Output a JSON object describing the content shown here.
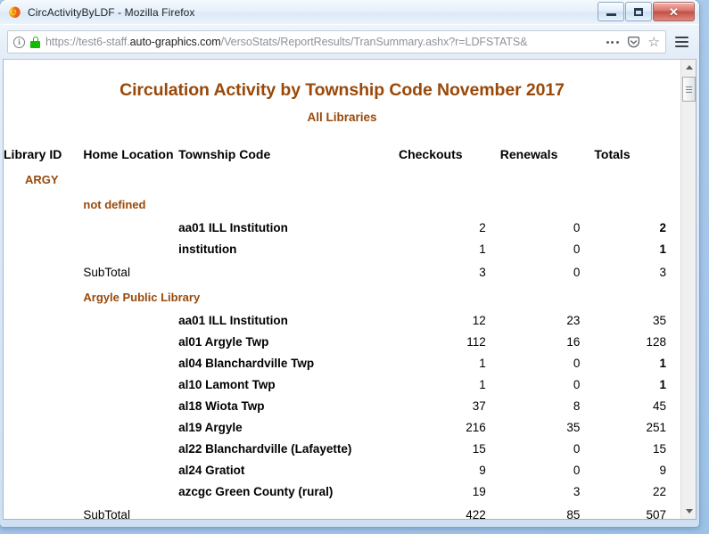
{
  "window": {
    "title": "CircActivityByLDF - Mozilla Firefox",
    "minimize_label": "Minimize",
    "maximize_label": "Maximize",
    "close_label": "✕"
  },
  "browser": {
    "url_prefix": "https://test6-staff.",
    "url_domain": "auto-graphics.com",
    "url_suffix": "/VersoStats/ReportResults/TranSummary.ashx?r=LDFSTATS&",
    "info_glyph": "i",
    "star_glyph": "☆",
    "icons": {
      "info": "info-icon",
      "lock": "padlock-icon",
      "page_actions": "ellipsis-icon",
      "pocket": "pocket-icon",
      "bookmark": "star-icon",
      "menu": "hamburger-icon"
    }
  },
  "report": {
    "title": "Circulation Activity by Township Code  November 2017",
    "subtitle": "All Libraries",
    "columns": [
      "Library ID",
      "Home Location",
      "Township Code",
      "Checkouts",
      "Renewals",
      "Totals"
    ],
    "rows": [
      {
        "kind": "library",
        "label": "ARGY"
      },
      {
        "kind": "home",
        "label": "not defined"
      },
      {
        "kind": "data",
        "label": "aa01 ILL Institution",
        "checkouts": "2",
        "renewals": "0",
        "totals": "2",
        "totals_bold": true
      },
      {
        "kind": "data",
        "label": "institution",
        "checkouts": "1",
        "renewals": "0",
        "totals": "1",
        "totals_bold": true
      },
      {
        "kind": "subtotal",
        "label": "SubTotal",
        "checkouts": "3",
        "renewals": "0",
        "totals": "3",
        "totals_bold": false
      },
      {
        "kind": "home",
        "label": "Argyle Public Library"
      },
      {
        "kind": "data",
        "label": "aa01 ILL Institution",
        "checkouts": "12",
        "renewals": "23",
        "totals": "35",
        "totals_bold": false
      },
      {
        "kind": "data",
        "label": "al01 Argyle Twp",
        "checkouts": "112",
        "renewals": "16",
        "totals": "128",
        "totals_bold": false
      },
      {
        "kind": "data",
        "label": "al04 Blanchardville Twp",
        "checkouts": "1",
        "renewals": "0",
        "totals": "1",
        "totals_bold": true
      },
      {
        "kind": "data",
        "label": "al10 Lamont Twp",
        "checkouts": "1",
        "renewals": "0",
        "totals": "1",
        "totals_bold": true
      },
      {
        "kind": "data",
        "label": "al18 Wiota Twp",
        "checkouts": "37",
        "renewals": "8",
        "totals": "45",
        "totals_bold": false
      },
      {
        "kind": "data",
        "label": "al19 Argyle",
        "checkouts": "216",
        "renewals": "35",
        "totals": "251",
        "totals_bold": false
      },
      {
        "kind": "data",
        "label": "al22 Blanchardville (Lafayette)",
        "checkouts": "15",
        "renewals": "0",
        "totals": "15",
        "totals_bold": false
      },
      {
        "kind": "data",
        "label": "al24 Gratiot",
        "checkouts": "9",
        "renewals": "0",
        "totals": "9",
        "totals_bold": false
      },
      {
        "kind": "data",
        "label": "azcgc Green County (rural)",
        "checkouts": "19",
        "renewals": "3",
        "totals": "22",
        "totals_bold": false
      },
      {
        "kind": "subtotal",
        "label": "SubTotal",
        "checkouts": "422",
        "renewals": "85",
        "totals": "507",
        "totals_bold": false
      }
    ]
  },
  "colors": {
    "report_accent": "#99490a",
    "lock_green": "#12bc00",
    "close_red": "#c14f45"
  }
}
